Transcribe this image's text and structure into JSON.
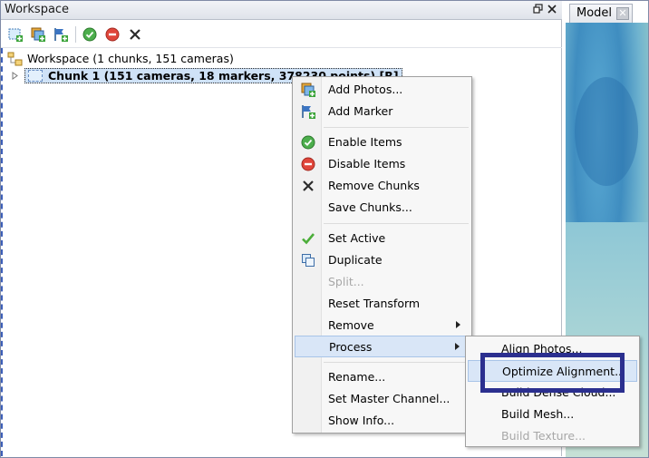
{
  "workspace_panel": {
    "title": "Workspace",
    "float_icon": "restore-icon",
    "close_icon": "close-icon"
  },
  "toolbar": {
    "buttons": [
      {
        "name": "add-chunk",
        "icon": "add-chunk-icon"
      },
      {
        "name": "add-photos",
        "icon": "add-photos-icon"
      },
      {
        "name": "add-marker",
        "icon": "add-marker-icon"
      },
      {
        "name": "enable-items",
        "icon": "enable-icon"
      },
      {
        "name": "disable-items",
        "icon": "disable-icon"
      },
      {
        "name": "remove",
        "icon": "remove-icon"
      }
    ]
  },
  "tree": {
    "root_label": "Workspace (1 chunks, 151 cameras)",
    "chunk_label": "Chunk 1 (151 cameras, 18 markers, 378230 points) [R]"
  },
  "model_panel": {
    "tab_label": "Model",
    "close_glyph": "✕"
  },
  "context_menu": {
    "items": [
      {
        "label": "Add Photos...",
        "icon": "add-photos-icon"
      },
      {
        "label": "Add Marker",
        "icon": "add-marker-icon"
      },
      {
        "label": "Enable Items",
        "icon": "enable-icon"
      },
      {
        "label": "Disable Items",
        "icon": "disable-icon"
      },
      {
        "label": "Remove Chunks",
        "icon": "remove-icon"
      },
      {
        "label": "Save Chunks..."
      },
      {
        "label": "Set Active",
        "icon": "checkmark-icon"
      },
      {
        "label": "Duplicate",
        "icon": "duplicate-icon"
      },
      {
        "label": "Split...",
        "disabled": true
      },
      {
        "label": "Reset Transform"
      },
      {
        "label": "Remove",
        "submenu": true
      },
      {
        "label": "Process",
        "submenu": true,
        "active": true
      },
      {
        "label": "Rename..."
      },
      {
        "label": "Set Master Channel..."
      },
      {
        "label": "Show Info..."
      }
    ]
  },
  "process_submenu": {
    "items": [
      {
        "label": "Align Photos..."
      },
      {
        "label": "Optimize Alignment...",
        "active": true
      },
      {
        "label": "Build Dense Cloud..."
      },
      {
        "label": "Build Mesh..."
      },
      {
        "label": "Build Texture...",
        "disabled": true
      }
    ]
  },
  "colors": {
    "highlight_box": "#2b2f8f",
    "selection": "#cfe2f7",
    "menu_hover": "#d9e6f7"
  }
}
